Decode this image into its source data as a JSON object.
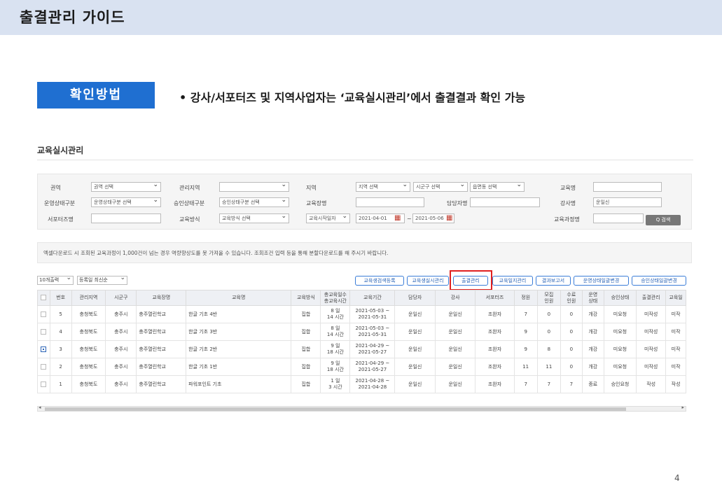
{
  "slide": {
    "title": "출결관리 가이드",
    "method_label": "확인방법",
    "method_text": "•  강사/서포터즈 및 지역사업자는 ‘교육실시관리’에서 출결결과 확인 가능",
    "page_number": "4"
  },
  "system": {
    "title": "교육실시관리"
  },
  "search": {
    "region_label": "권역",
    "region_value": "권역 선택",
    "mgmt_region_label": "관리지역",
    "mgmt_region_value": "",
    "area_label": "지역",
    "area_value": "지역 선택",
    "district_value": "시군구 선택",
    "town_value": "읍면동 선택",
    "edu_name_label": "교육명",
    "edu_name_value": "",
    "op_status_label": "운영상태구분",
    "op_status_value": "운영상태구분 선택",
    "approval_label": "승인상태구분",
    "approval_value": "승인상태구분 선택",
    "venue_label": "교육장명",
    "venue_value": "",
    "manager_label": "담당자명",
    "manager_value": "",
    "instructor_label": "강사명",
    "instructor_value": "운일신",
    "supporter_label": "서포터즈명",
    "supporter_value": "",
    "method_label": "교육방식",
    "method_value": "교육방식 선택",
    "date_type_value": "교육시작일자",
    "date_from": "2021-04-01",
    "date_tilde": "~",
    "date_to": "2021-05-06",
    "course_name_label": "교육과정명",
    "course_name_value": "",
    "search_button": "Q 검색"
  },
  "notice": "엑셀다운로드 시 조회된 교육과정이 1,000건이 넘는 경우 역량향상도를 못 가져올 수 있습니다. 조회조건 입력 등을 통해 분할다운로드를 해 주시기 바랍니다.",
  "toolbar": {
    "page_size": "10개출력",
    "sort": "등록일 최신순",
    "buttons": [
      "교육생검색등록",
      "교육생실시관리",
      "출결관리",
      "교육일지관리",
      "결과보고서",
      "운영상태일괄변경",
      "승인상태일괄변경"
    ]
  },
  "table": {
    "headers": [
      "번호",
      "관리지역",
      "시군구",
      "교육장명",
      "교육명",
      "교육방식",
      "총교육일수\n총교육시간",
      "교육기간",
      "담당자",
      "강사",
      "서포터즈",
      "정원",
      "모집\n인원",
      "수료\n인원",
      "운영\n상태",
      "승인상태",
      "출결관리",
      "교육일"
    ],
    "rows": [
      {
        "checked": false,
        "no": "5",
        "region": "충청북도",
        "district": "충주시",
        "venue": "충주열린학교",
        "name": "한글 기초 4반",
        "method": "집합",
        "days": "8 일",
        "hours": "14 시간",
        "period_start": "2021-05-03 ~",
        "period_end": "2021-05-31",
        "manager": "운일신",
        "instructor": "운일신",
        "supporter": "조완자",
        "capacity": "7",
        "recruited": "0",
        "completed": "0",
        "op_status": "개강",
        "approval": "미요청",
        "attendance": "미작성",
        "edu_log": "미작"
      },
      {
        "checked": false,
        "no": "4",
        "region": "충청북도",
        "district": "충주시",
        "venue": "충주열린학교",
        "name": "한글 기초 3반",
        "method": "집합",
        "days": "8 일",
        "hours": "14 시간",
        "period_start": "2021-05-03 ~",
        "period_end": "2021-05-31",
        "manager": "운일신",
        "instructor": "운일신",
        "supporter": "조완자",
        "capacity": "9",
        "recruited": "0",
        "completed": "0",
        "op_status": "개강",
        "approval": "미요청",
        "attendance": "미작성",
        "edu_log": "미작"
      },
      {
        "checked": true,
        "no": "3",
        "region": "충청북도",
        "district": "충주시",
        "venue": "충주열린학교",
        "name": "한글 기초 2반",
        "method": "집합",
        "days": "9 일",
        "hours": "18 시간",
        "period_start": "2021-04-29 ~",
        "period_end": "2021-05-27",
        "manager": "운일신",
        "instructor": "운일신",
        "supporter": "조완자",
        "capacity": "9",
        "recruited": "8",
        "completed": "0",
        "op_status": "개강",
        "approval": "미요청",
        "attendance": "미작성",
        "edu_log": "미작"
      },
      {
        "checked": false,
        "no": "2",
        "region": "충청북도",
        "district": "충주시",
        "venue": "충주열린학교",
        "name": "한글 기초 1반",
        "method": "집합",
        "days": "9 일",
        "hours": "18 시간",
        "period_start": "2021-04-29 ~",
        "period_end": "2021-05-27",
        "manager": "운일신",
        "instructor": "운일신",
        "supporter": "조완자",
        "capacity": "11",
        "recruited": "11",
        "completed": "0",
        "op_status": "개강",
        "approval": "미요청",
        "attendance": "미작성",
        "edu_log": "미작"
      },
      {
        "checked": false,
        "no": "1",
        "region": "충청북도",
        "district": "충주시",
        "venue": "충주열린학교",
        "name": "파워포인트 기초",
        "method": "집합",
        "days": "1 일",
        "hours": "3 시간",
        "period_start": "2021-04-28 ~",
        "period_end": "2021-04-28",
        "manager": "운일신",
        "instructor": "운일신",
        "supporter": "조완자",
        "capacity": "7",
        "recruited": "7",
        "completed": "7",
        "op_status": "종료",
        "approval": "승인요청",
        "attendance": "작성",
        "edu_log": "작성"
      }
    ]
  },
  "colors": {
    "header_band": "#d9e2f1",
    "method_box": "#1f6fd1",
    "highlight": "#e02020",
    "button_border": "#3b7dd8"
  }
}
